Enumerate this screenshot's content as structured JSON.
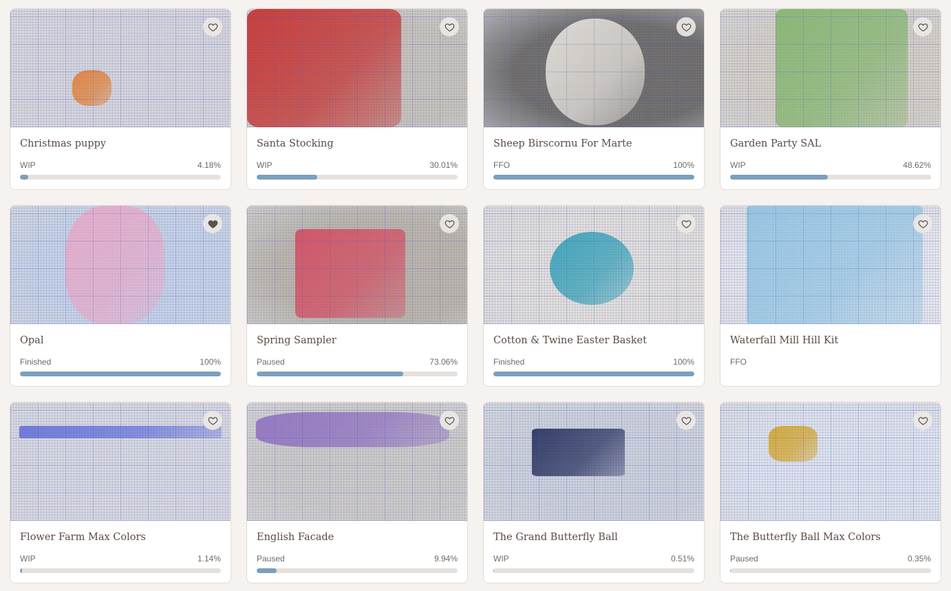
{
  "projects": [
    {
      "title": "Christmas puppy",
      "status": "WIP",
      "percent": "4.18%",
      "progress": 0.0418,
      "favorited": false,
      "bg": "#d7d6da",
      "accent": "#e07a2e"
    },
    {
      "title": "Santa Stocking",
      "status": "WIP",
      "percent": "30.01%",
      "progress": 0.3001,
      "favorited": false,
      "bg": "#c9c3b8",
      "accent": "#c42727"
    },
    {
      "title": "Sheep Birscornu For Marte",
      "status": "FFO",
      "percent": "100%",
      "progress": 1,
      "favorited": false,
      "bg": "#6e6a63",
      "accent": "#f1ece6"
    },
    {
      "title": "Garden Party SAL",
      "status": "WIP",
      "percent": "48.62%",
      "progress": 0.4862,
      "favorited": false,
      "bg": "#d8d0c2",
      "accent": "#7fb36a"
    },
    {
      "title": "Opal",
      "status": "Finished",
      "percent": "100%",
      "progress": 1,
      "favorited": true,
      "bg": "#c7d3e6",
      "accent": "#e8a6c6"
    },
    {
      "title": "Spring Sampler",
      "status": "Paused",
      "percent": "73.06%",
      "progress": 0.7306,
      "favorited": false,
      "bg": "#bdb5a6",
      "accent": "#d4485e"
    },
    {
      "title": "Cotton & Twine Easter Basket",
      "status": "Finished",
      "percent": "100%",
      "progress": 1,
      "favorited": false,
      "bg": "#e4e0da",
      "accent": "#2a9bb5"
    },
    {
      "title": "Waterfall Mill Hill Kit",
      "status": "FFO",
      "percent": "",
      "progress": null,
      "favorited": false,
      "bg": "#e8e8ec",
      "accent": "#8cc0e0"
    },
    {
      "title": "Flower Farm Max Colors",
      "status": "WIP",
      "percent": "1.14%",
      "progress": 0.0114,
      "favorited": false,
      "bg": "#d9d9e0",
      "accent": "#5f6ad8"
    },
    {
      "title": "English Facade",
      "status": "Paused",
      "percent": "9.94%",
      "progress": 0.0994,
      "favorited": false,
      "bg": "#cfcbc6",
      "accent": "#8a6bbf"
    },
    {
      "title": "The Grand Butterfly Ball",
      "status": "WIP",
      "percent": "0.51%",
      "progress": 0.0051,
      "favorited": false,
      "bg": "#cfd2da",
      "accent": "#1e2756"
    },
    {
      "title": "The Butterfly Ball Max Colors",
      "status": "Paused",
      "percent": "0.35%",
      "progress": 0.0035,
      "favorited": false,
      "bg": "#dfe4ec",
      "accent": "#d1a021"
    }
  ],
  "icons": {
    "favorite": "heart-icon"
  },
  "colors": {
    "progress_fill": "#7a9fbd",
    "progress_track": "#e6e1dc",
    "page_bg": "#f5f2ef"
  }
}
